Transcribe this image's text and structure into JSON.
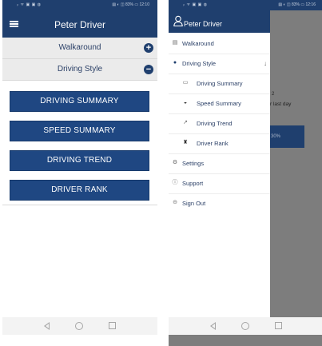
{
  "left_screen": {
    "status_bar": {
      "left": "ᵢₗ ᯤ ▣ ▣ ◍",
      "right": "▤ ◐ ◫ 83% ▭ 12:10"
    },
    "app_bar": {
      "title": "Peter Driver"
    },
    "sections": [
      {
        "label": "Walkaround",
        "icon": "plus-icon"
      },
      {
        "label": "Driving Style",
        "icon": "minus-icon"
      }
    ],
    "buttons": [
      "DRIVING SUMMARY",
      "SPEED SUMMARY",
      "DRIVING TREND",
      "DRIVER RANK"
    ]
  },
  "right_screen": {
    "status_bar": {
      "left": "ᵢₗ ᯤ ▣ ▣ ◍",
      "right": "▤ ◐ ◫ 83% ▭ 12:16"
    },
    "drawer": {
      "title": "Peter Driver",
      "items": [
        {
          "label": "Walkaround",
          "icon": "clipboard-icon"
        },
        {
          "label": "Driving Style",
          "icon": "person-icon"
        },
        {
          "label": "Driving Summary",
          "icon": "summary-card-icon"
        },
        {
          "label": "Speed Summary",
          "icon": "speedometer-icon"
        },
        {
          "label": "Driving Trend",
          "icon": "trend-chart-icon"
        },
        {
          "label": "Driver Rank",
          "icon": "trophy-icon"
        },
        {
          "label": "Settings",
          "icon": "gear-icon"
        },
        {
          "label": "Support",
          "icon": "help-icon"
        },
        {
          "label": "Sign Out",
          "icon": "sign-out-icon"
        }
      ]
    },
    "background": {
      "text1": "2",
      "text2": "r last day",
      "button": "30%"
    }
  },
  "colors": {
    "primary": "#1f3f6e",
    "button": "#1f4782",
    "section_bg": "#ebebeb"
  }
}
